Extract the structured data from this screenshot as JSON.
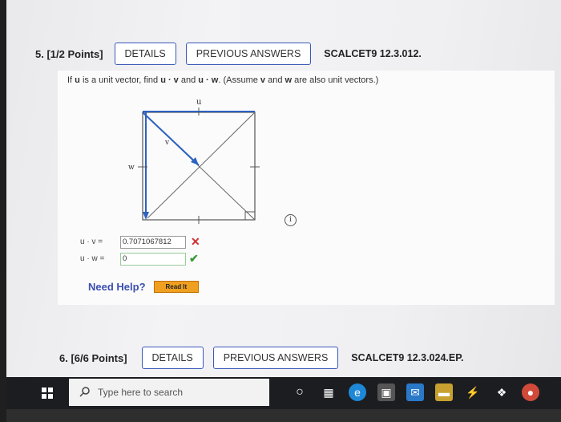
{
  "question5": {
    "number": "5. [1/2 Points]",
    "details_label": "DETAILS",
    "previous_answers_label": "PREVIOUS ANSWERS",
    "source": "SCALCET9 12.3.012.",
    "prompt_pre": "If ",
    "prompt_u": "u",
    "prompt_mid1": " is a unit vector, find ",
    "prompt_uv": "u · v",
    "prompt_and": " and ",
    "prompt_uw": "u · w",
    "prompt_mid2": ". (Assume ",
    "prompt_v": "v",
    "prompt_and2": " and ",
    "prompt_w": "w",
    "prompt_end": " are also unit vectors.)",
    "diagram": {
      "label_u": "u",
      "label_v": "v",
      "label_w": "w"
    },
    "info_glyph": "i",
    "answers": [
      {
        "label": "u · v =",
        "value": "0.7071067812",
        "status": "incorrect",
        "mark": "✕"
      },
      {
        "label": "u · w =",
        "value": "0",
        "status": "correct",
        "mark": "✔"
      }
    ],
    "need_help": "Need Help?",
    "read_it": "Read It"
  },
  "question6": {
    "number": "6. [6/6 Points]",
    "details_label": "DETAILS",
    "previous_answers_label": "PREVIOUS ANSWERS",
    "source": "SCALCET9 12.3.024.EP."
  },
  "taskbar": {
    "search_placeholder": "Type here to search",
    "icons": [
      "cortana-icon",
      "task-view-icon",
      "edge-icon",
      "store-icon",
      "mail-icon",
      "files-icon",
      "bolt-icon",
      "dropbox-icon",
      "chrome-icon"
    ]
  },
  "colors": {
    "button_border": "#3a59b8",
    "help_link": "#3a4fae",
    "incorrect": "#d03030",
    "correct": "#3a9a3a",
    "read_it": "#f0a020"
  }
}
